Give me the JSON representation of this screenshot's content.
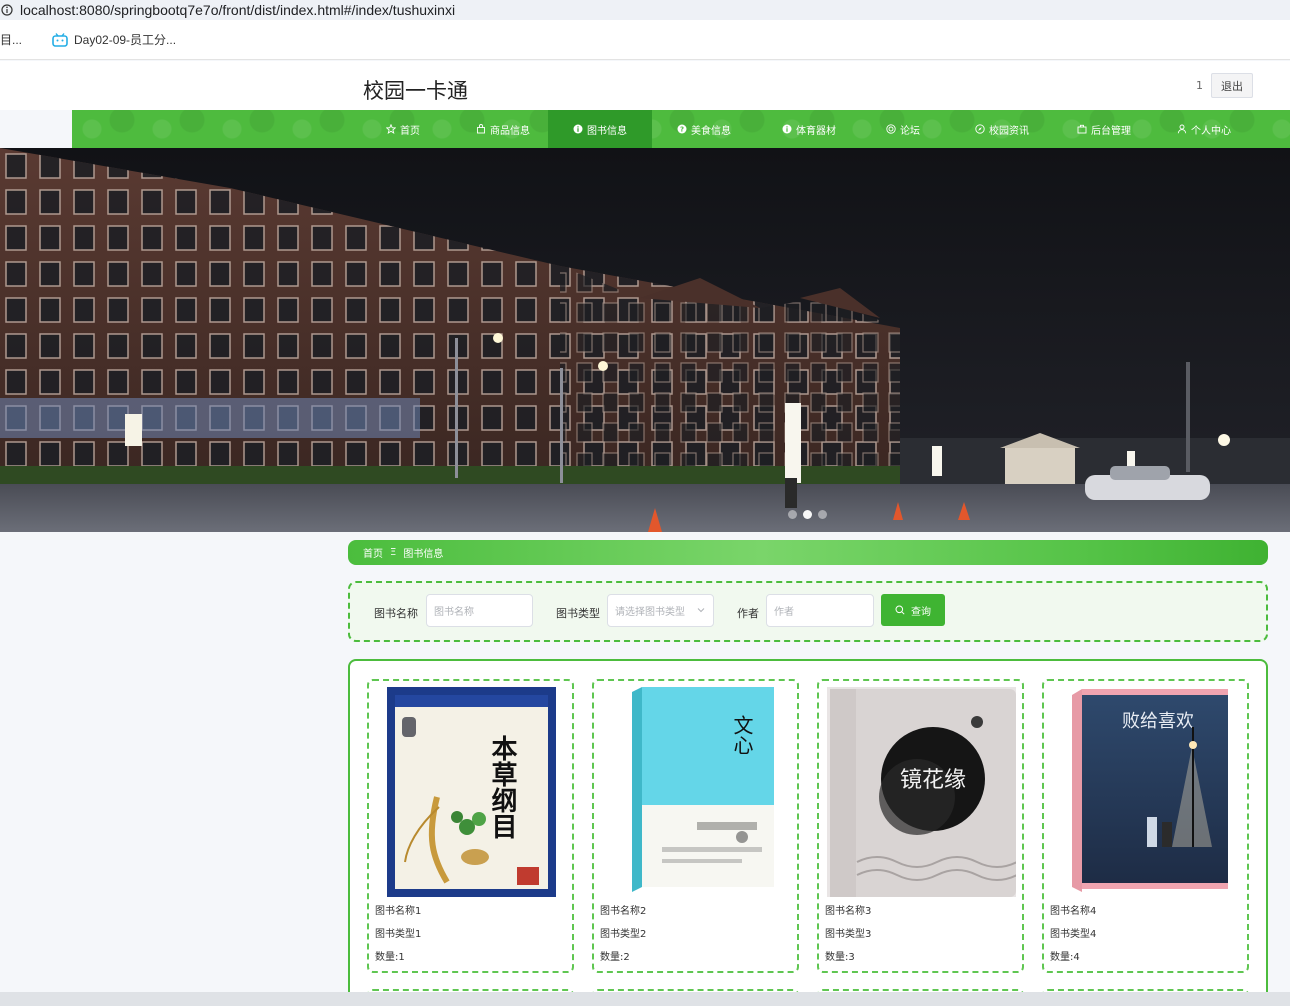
{
  "browser": {
    "url": "localhost:8080/springbootq7e7o/front/dist/index.html#/index/tushuxinxi",
    "bookmarks": [
      "目...",
      "Day02-09-员工分..."
    ]
  },
  "header": {
    "title": "校园一卡通",
    "user": "1",
    "logout_label": "退出"
  },
  "nav": {
    "items": [
      {
        "label": "首页",
        "icon": "star-icon"
      },
      {
        "label": "商品信息",
        "icon": "bag-icon"
      },
      {
        "label": "图书信息",
        "icon": "info-icon",
        "active": true
      },
      {
        "label": "美食信息",
        "icon": "question-icon"
      },
      {
        "label": "体育器材",
        "icon": "info-icon"
      },
      {
        "label": "论坛",
        "icon": "target-icon"
      },
      {
        "label": "校园资讯",
        "icon": "compass-icon"
      },
      {
        "label": "后台管理",
        "icon": "briefcase-icon"
      },
      {
        "label": "个人中心",
        "icon": "user-icon"
      }
    ]
  },
  "banner": {
    "slides": 3,
    "active_slide": 2
  },
  "breadcrumb": {
    "home": "首页",
    "separator": "Ξ",
    "current": "图书信息"
  },
  "search": {
    "name_label": "图书名称",
    "name_placeholder": "图书名称",
    "type_label": "图书类型",
    "type_placeholder": "请选择图书类型",
    "author_label": "作者",
    "author_placeholder": "作者",
    "button_label": "查询"
  },
  "books": [
    {
      "name": "图书名称1",
      "type": "图书类型1",
      "qty": "数量:1",
      "cover_text": "本草纲目"
    },
    {
      "name": "图书名称2",
      "type": "图书类型2",
      "qty": "数量:2",
      "cover_text": "文心"
    },
    {
      "name": "图书名称3",
      "type": "图书类型3",
      "qty": "数量:3",
      "cover_text": "镜花缘"
    },
    {
      "name": "图书名称4",
      "type": "图书类型4",
      "qty": "数量:4",
      "cover_text": "败给喜欢"
    }
  ],
  "colors": {
    "primary": "#4ebb3e",
    "active": "#2f9a29",
    "bg": "#f5f7fa"
  }
}
